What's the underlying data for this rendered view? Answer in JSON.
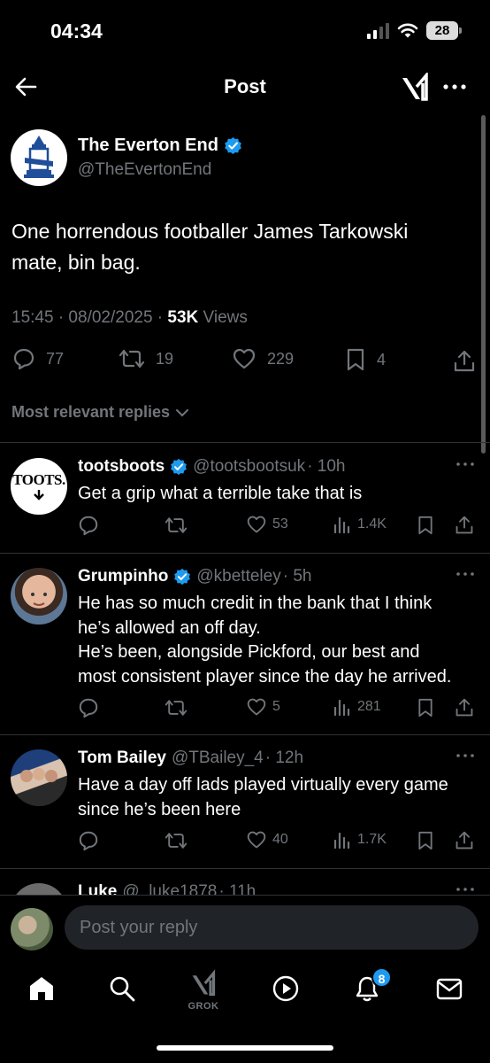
{
  "status_bar": {
    "time": "04:34",
    "battery": "28"
  },
  "header": {
    "title": "Post"
  },
  "post": {
    "author_name": "The Everton End",
    "author_handle": "@TheEvertonEnd",
    "text_line1": "One horrendous footballer James Tarkowski",
    "text_line2": "mate, bin bag.",
    "timestamp": "15:45 · 08/02/2025 · ",
    "views_count": "53K",
    "views_label": " Views",
    "replies": "77",
    "reposts": "19",
    "likes": "229",
    "bookmarks": "4",
    "sort_label": "Most relevant replies"
  },
  "replies": [
    {
      "name": "tootsboots",
      "handle": "@tootsbootsuk",
      "time": "· 10h",
      "avatar_text": "TOOTS.",
      "lines": [
        "Get a grip what a terrible take that is"
      ],
      "likes": "53",
      "views": "1.4K"
    },
    {
      "name": "Grumpinho",
      "handle": "@kbetteley",
      "time": "· 5h",
      "lines": [
        "He has so much credit in the bank that I think",
        "he’s allowed an off day.",
        "He’s been, alongside Pickford, our best and",
        "most consistent player since the day he arrived."
      ],
      "likes": "5",
      "views": "281"
    },
    {
      "name": "Tom Bailey",
      "handle": "@TBailey_4",
      "time": "· 12h",
      "lines": [
        "Have a day off lads played virtually every game",
        "since he’s been here"
      ],
      "likes": "40",
      "views": "1.7K"
    },
    {
      "name": "Luke",
      "handle": "@_luke1878",
      "time": "· 11h"
    }
  ],
  "composer": {
    "placeholder": "Post your reply"
  },
  "nav": {
    "grok_label": "GROK",
    "notifications_badge": "8"
  },
  "colors": {
    "accent": "#1d9bf0",
    "muted": "#71767b",
    "background": "#000000"
  }
}
